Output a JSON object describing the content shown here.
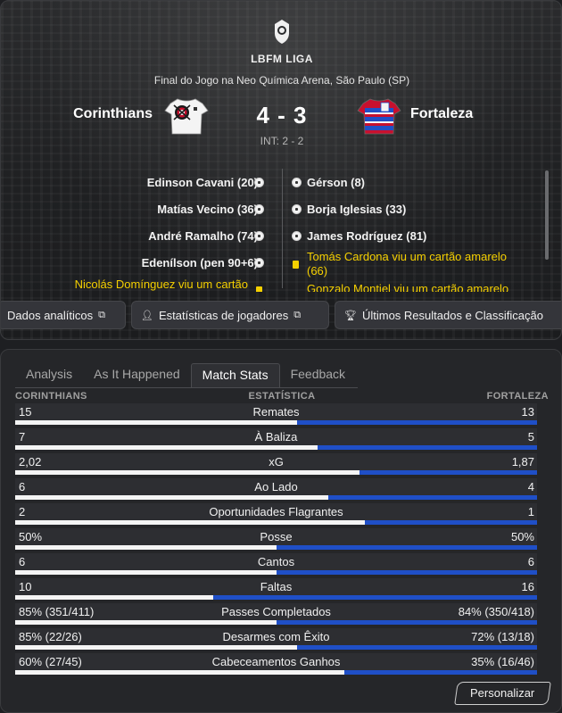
{
  "header": {
    "league": "LBFM LIGA",
    "venue": "Final do Jogo na Neo Química Arena, São Paulo (SP)",
    "home_team": "Corinthians",
    "away_team": "Fortaleza",
    "score": "4 - 3",
    "interval": "INT: 2 - 2"
  },
  "events": {
    "home_goals": [
      "Edinson Cavani (20)",
      "Matías Vecino (36)",
      "André Ramalho (74)",
      "Edenílson (pen 90+6)"
    ],
    "away_goals": [
      "Gérson (8)",
      "Borja Iglesias (33)",
      "James Rodríguez (81)"
    ],
    "home_card": "Nicolás Domínguez viu um cartão",
    "away_card_1_line1": "Tomás Cardona viu um cartão amarelo",
    "away_card_1_line2": "(66)",
    "away_card_2": "Gonzalo Montiel viu um cartão amarelo"
  },
  "buttons": {
    "analytics": "Dados analíticos",
    "player_stats": "Estatísticas de jogadores",
    "results": "Últimos Resultados e Classificação"
  },
  "tabs": [
    "Analysis",
    "As It Happened",
    "Match Stats",
    "Feedback"
  ],
  "columns": {
    "home": "CORINTHIANS",
    "stat": "ESTATÍSTICA",
    "away": "FORTALEZA"
  },
  "stats": [
    {
      "label": "Remates",
      "home": "15",
      "away": "13",
      "home_share": 0.54
    },
    {
      "label": "À Baliza",
      "home": "7",
      "away": "5",
      "home_share": 0.58
    },
    {
      "label": "xG",
      "home": "2,02",
      "away": "1,87",
      "home_share": 0.66
    },
    {
      "label": "Ao Lado",
      "home": "6",
      "away": "4",
      "home_share": 0.6
    },
    {
      "label": "Oportunidades Flagrantes",
      "home": "2",
      "away": "1",
      "home_share": 0.67
    },
    {
      "label": "Posse",
      "home": "50%",
      "away": "50%",
      "home_share": 0.5
    },
    {
      "label": "Cantos",
      "home": "6",
      "away": "6",
      "home_share": 0.5
    },
    {
      "label": "Faltas",
      "home": "10",
      "away": "16",
      "home_share": 0.38
    },
    {
      "label": "Passes Completados",
      "home": "85% (351/411)",
      "away": "84% (350/418)",
      "home_share": 0.5
    },
    {
      "label": "Desarmes com Êxito",
      "home": "85% (22/26)",
      "away": "72% (13/18)",
      "home_share": 0.54
    },
    {
      "label": "Cabeceamentos Ganhos",
      "home": "60% (27/45)",
      "away": "35% (16/46)",
      "home_share": 0.63
    }
  ],
  "personalize_label": "Personalizar",
  "colors": {
    "away_bar": "#1f4fc7",
    "home_bar": "#f4f4f4",
    "card": "#f5d000"
  }
}
